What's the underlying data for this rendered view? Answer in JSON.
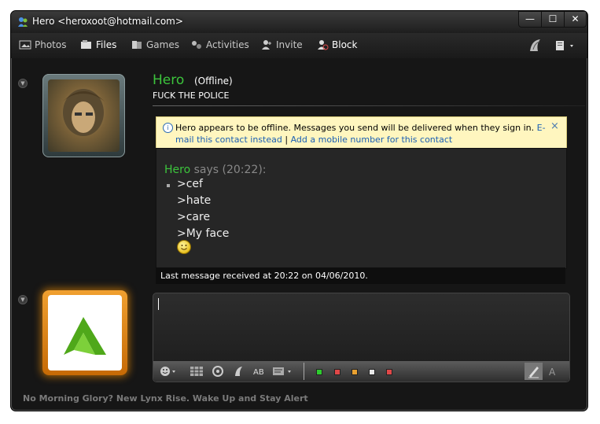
{
  "window": {
    "title": "Hero <heroxoot@hotmail.com>",
    "controls": {
      "minimize": "—",
      "maximize": "☐",
      "close": "✕"
    }
  },
  "toolbar": {
    "items": [
      {
        "label": "Photos",
        "icon": "photos-icon"
      },
      {
        "label": "Files",
        "icon": "files-icon"
      },
      {
        "label": "Games",
        "icon": "games-icon"
      },
      {
        "label": "Activities",
        "icon": "activities-icon"
      },
      {
        "label": "Invite",
        "icon": "invite-icon"
      },
      {
        "label": "Block",
        "icon": "block-icon"
      }
    ]
  },
  "contact": {
    "name": "Hero",
    "status": "(Offline)",
    "personal_message": "FUCK THE POLICE"
  },
  "notice": {
    "text": "Hero appears to be offline. Messages you send will be delivered when they sign in.",
    "link_email": "E-mail this contact instead",
    "separator": "|",
    "link_mobile": "Add a mobile number for this contact",
    "close": "×"
  },
  "conversation": {
    "sender": "Hero",
    "says": "says (20:22):",
    "messages": [
      ">cef",
      ">hate",
      ">care",
      ">My face"
    ]
  },
  "last_message": "Last message received at 20:22 on 04/06/2010.",
  "ad_text": "No Morning Glory? New Lynx Rise. Wake Up and Stay Alert",
  "format_bar": {
    "colors": [
      "#2ecc2e",
      "#e04848",
      "#e8a030",
      "#e8e8e8",
      "#e04848"
    ]
  }
}
